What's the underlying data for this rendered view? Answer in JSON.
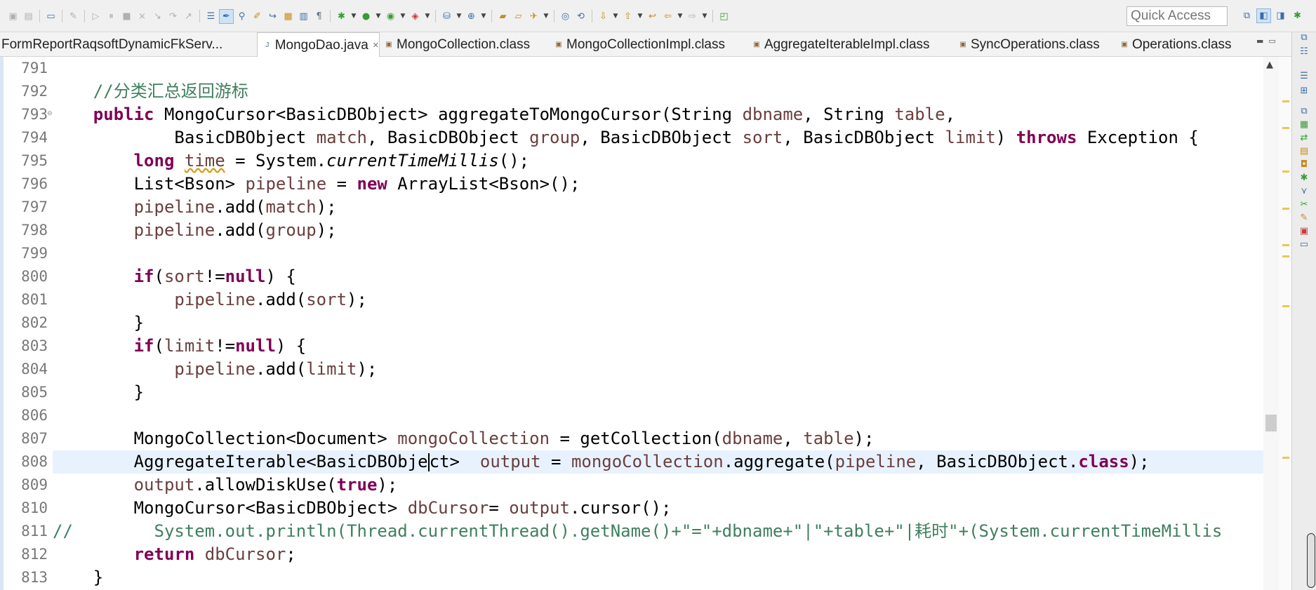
{
  "window": {
    "quick_access_placeholder": "Quick Access"
  },
  "toolbar": {
    "icons": [
      "save-icon",
      "save-all-icon",
      "console-icon",
      "pin-icon",
      "resume-icon",
      "suspend-icon",
      "terminate-icon",
      "disconnect-icon",
      "step-into-icon",
      "step-over-icon",
      "step-return-icon",
      "open-type-icon",
      "toggle-mark-occurrences-icon",
      "search-icon",
      "pen-icon",
      "open-task-icon",
      "open-declaration-icon",
      "show-whitespace-icon",
      "debug-icon",
      "run-icon",
      "run-last-icon",
      "external-tools-icon",
      "new-server-icon",
      "new-web-icon",
      "open-folder-icon",
      "new-folder-icon",
      "search-file-icon",
      "next-annotation-icon",
      "prev-annotation-icon",
      "last-edit-icon",
      "back-icon",
      "forward-icon",
      "open-perspective-icon"
    ]
  },
  "tabs": [
    {
      "label": "FormReportRaqsoftDynamicFkServ...",
      "active": false
    },
    {
      "label": "MongoDao.java",
      "active": true
    },
    {
      "label": "MongoCollection.class",
      "active": false
    },
    {
      "label": "MongoCollectionImpl.class",
      "active": false
    },
    {
      "label": "AggregateIterableImpl.class",
      "active": false
    },
    {
      "label": "SyncOperations.class",
      "active": false
    },
    {
      "label": "Operations.class",
      "active": false
    }
  ],
  "editor": {
    "current_line": 808,
    "lines": [
      {
        "n": "791",
        "text": ""
      },
      {
        "n": "792",
        "text": "    //分类汇总返回游标"
      },
      {
        "n": "793",
        "text": "    public MongoCursor<BasicDBObject> aggregateToMongoCursor(String dbname, String table,"
      },
      {
        "n": "794",
        "text": "            BasicDBObject match, BasicDBObject group, BasicDBObject sort, BasicDBObject limit) throws Exception {"
      },
      {
        "n": "795",
        "text": "        long time = System.currentTimeMillis();"
      },
      {
        "n": "796",
        "text": "        List<Bson> pipeline = new ArrayList<Bson>();"
      },
      {
        "n": "797",
        "text": "        pipeline.add(match);"
      },
      {
        "n": "798",
        "text": "        pipeline.add(group);"
      },
      {
        "n": "799",
        "text": ""
      },
      {
        "n": "800",
        "text": "        if(sort!=null) {"
      },
      {
        "n": "801",
        "text": "            pipeline.add(sort);"
      },
      {
        "n": "802",
        "text": "        }"
      },
      {
        "n": "803",
        "text": "        if(limit!=null) {"
      },
      {
        "n": "804",
        "text": "            pipeline.add(limit);"
      },
      {
        "n": "805",
        "text": "        }"
      },
      {
        "n": "806",
        "text": ""
      },
      {
        "n": "807",
        "text": "        MongoCollection<Document> mongoCollection = getCollection(dbname, table);"
      },
      {
        "n": "808",
        "text": "        AggregateIterable<BasicDBObject>  output = mongoCollection.aggregate(pipeline, BasicDBObject.class);"
      },
      {
        "n": "809",
        "text": "        output.allowDiskUse(true);"
      },
      {
        "n": "810",
        "text": "        MongoCursor<BasicDBObject> dbCursor= output.cursor();"
      },
      {
        "n": "811",
        "text": "//        System.out.println(Thread.currentThread().getName()+\"=\"+dbname+\"|\"+table+\"|耗时\"+(System.currentTimeMillis"
      },
      {
        "n": "812",
        "text": "        return dbCursor;"
      },
      {
        "n": "813",
        "text": "    }"
      }
    ]
  },
  "right_sidebar": {
    "icons": [
      "restore-icon",
      "outline-icon",
      "task-list-icon",
      "hierarchy-icon",
      "call-hierarchy-icon",
      "package-icon",
      "jar-icon",
      "debug-view-icon",
      "breakpoints-icon",
      "variables-icon",
      "expressions-icon",
      "wrench-icon",
      "problems-icon",
      "console-view-icon"
    ]
  },
  "colors": {
    "keyword": "#7f0055",
    "field": "#0000c0",
    "local_var": "#6a3e3e",
    "comment": "#3f7f5f",
    "current_line": "#e8f2fe",
    "left_ruler": "#d9e6f5"
  }
}
